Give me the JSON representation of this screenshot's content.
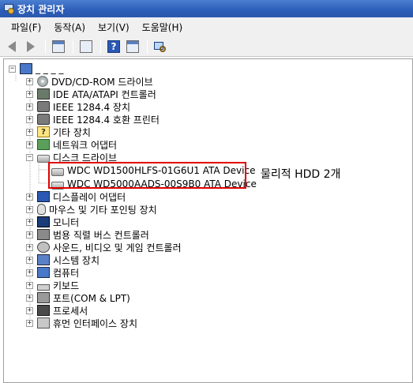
{
  "window": {
    "title": "장치 관리자"
  },
  "menu": {
    "items": [
      "파일(F)",
      "동작(A)",
      "보기(V)",
      "도움말(H)"
    ]
  },
  "toolbar": {
    "buttons": [
      "back-arrow-icon",
      "forward-arrow-icon",
      "properties-icon",
      "update-driver-icon",
      "help-icon",
      "console-tree-icon",
      "scan-hardware-icon"
    ],
    "help_glyph": "?"
  },
  "tree": {
    "root": {
      "label": "_ _ _ _"
    },
    "items": [
      {
        "label": "DVD/CD-ROM 드라이브",
        "expander": "+",
        "icon": "cd-icon"
      },
      {
        "label": "IDE ATA/ATAPI 컨트롤러",
        "expander": "+",
        "icon": "ide-controller-icon"
      },
      {
        "label": "IEEE 1284.4 장치",
        "expander": "+",
        "icon": "printer-port-icon"
      },
      {
        "label": "IEEE 1284.4 호환 프린터",
        "expander": "+",
        "icon": "printer-icon"
      },
      {
        "label": "기타 장치",
        "expander": "+",
        "icon": "unknown-device-icon"
      },
      {
        "label": "네트워크 어댑터",
        "expander": "+",
        "icon": "network-adapter-icon"
      },
      {
        "label": "디스크 드라이브",
        "expander": "−",
        "icon": "disk-drive-icon",
        "children": [
          {
            "label": "WDC WD1500HLFS-01G6U1 ATA Device",
            "icon": "hdd-icon"
          },
          {
            "label": "WDC WD5000AADS-00S9B0 ATA Device",
            "icon": "hdd-icon"
          }
        ]
      },
      {
        "label": "디스플레이 어댑터",
        "expander": "+",
        "icon": "display-adapter-icon"
      },
      {
        "label": "마우스 및 기타 포인팅 장치",
        "expander": "+",
        "icon": "mouse-icon"
      },
      {
        "label": "모니터",
        "expander": "+",
        "icon": "monitor-icon"
      },
      {
        "label": "범용 직렬 버스 컨트롤러",
        "expander": "+",
        "icon": "usb-icon"
      },
      {
        "label": "사운드, 비디오 및 게임 컨트롤러",
        "expander": "+",
        "icon": "sound-icon"
      },
      {
        "label": "시스템 장치",
        "expander": "+",
        "icon": "system-device-icon"
      },
      {
        "label": "컴퓨터",
        "expander": "+",
        "icon": "computer-icon"
      },
      {
        "label": "키보드",
        "expander": "+",
        "icon": "keyboard-icon"
      },
      {
        "label": "포트(COM & LPT)",
        "expander": "+",
        "icon": "port-icon"
      },
      {
        "label": "프로세서",
        "expander": "+",
        "icon": "processor-icon"
      },
      {
        "label": "휴먼 인터페이스 장치",
        "expander": "+",
        "icon": "hid-icon"
      }
    ]
  },
  "annotation": {
    "text": "물리적 HDD 2개",
    "box_color": "#e00000"
  },
  "colors": {
    "titlebar": "#2c5db8",
    "highlight_box": "#e00000"
  }
}
